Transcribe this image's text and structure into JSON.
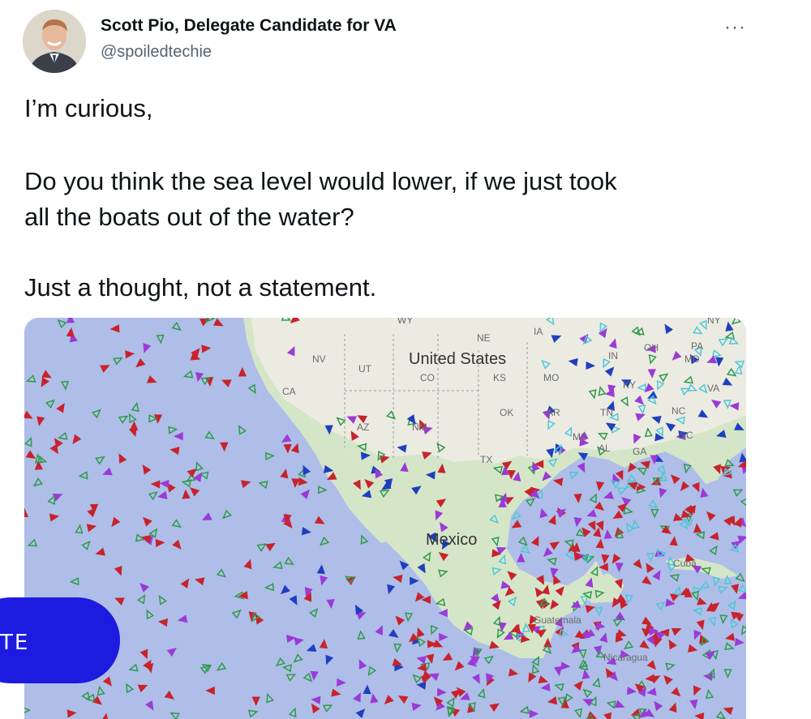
{
  "author": {
    "name": "Scott Pio, Delegate Candidate for VA",
    "handle": "@spoiledtechie"
  },
  "more_icon": "more-horizontal-icon",
  "more_glyph": "···",
  "tweet_lines": [
    "I’m curious,",
    "Do you think the sea level would lower, if we just took",
    "all the boats out of the water?",
    "Just a thought, not a statement."
  ],
  "map": {
    "labels": {
      "nv": "NV",
      "ut": "UT",
      "ca": "CA",
      "az": "AZ",
      "nm": "NM",
      "co": "CO",
      "ne": "NE",
      "ia": "IA",
      "ks": "KS",
      "mo": "MO",
      "ok": "OK",
      "ar": "AR",
      "tn": "TN",
      "ms": "MS",
      "al": "AL",
      "ga": "GA",
      "sc": "SC",
      "nc": "NC",
      "va": "VA",
      "ky": "KY",
      "in": "IN",
      "oh": "OH",
      "pa": "PA",
      "md": "MD",
      "tx": "TX",
      "wy": "WY",
      "ny": "NY",
      "united_states": "United States",
      "mexico": "Mexico",
      "guatemala": "Guatemala",
      "nicaragua": "Nicaragua",
      "cuba": "Cuba"
    },
    "colors": {
      "water": "#aebee8",
      "land": "#d5e6c8",
      "usa_land": "#ecebe2",
      "vessel_red": "#c8232d",
      "vessel_green": "#2f9a4a",
      "vessel_purple": "#9b3ad6",
      "vessel_blue": "#1f3fbf",
      "vessel_cyan": "#4fc7d6"
    }
  },
  "overlay_button": {
    "label": "TE",
    "color": "#1d1be0"
  }
}
